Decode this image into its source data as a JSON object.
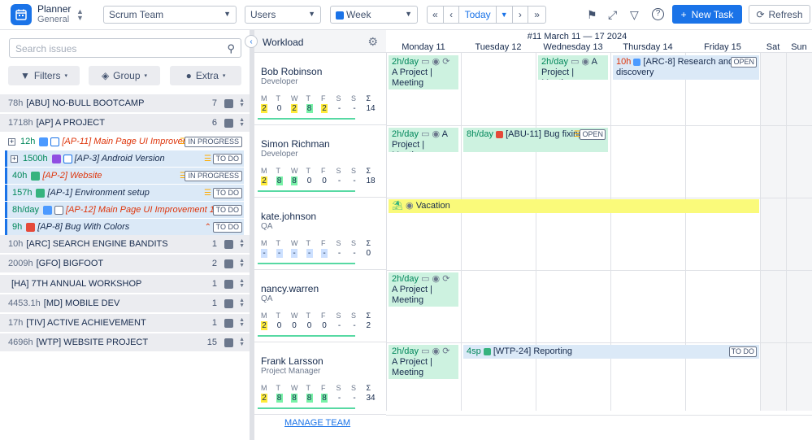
{
  "app": {
    "title": "Planner",
    "subtitle": "General"
  },
  "toolbar": {
    "team": "Scrum Team",
    "view": "Users",
    "range": "Week",
    "today": "Today",
    "new_task": "New Task",
    "refresh": "Refresh"
  },
  "sidebar": {
    "search_placeholder": "Search issues",
    "filters": "Filters",
    "group": "Group",
    "extra": "Extra",
    "projects": [
      {
        "hours": "78h",
        "name": "[ABU] NO-BULL BOOTCAMP",
        "count": "7"
      },
      {
        "hours": "1718h",
        "name": "[AP] A PROJECT",
        "count": "6"
      },
      {
        "hours": "10h",
        "name": "[ARC] SEARCH ENGINE BANDITS",
        "count": "1"
      },
      {
        "hours": "2009h",
        "name": "[GFO] BIGFOOT",
        "count": "2"
      },
      {
        "hours": "",
        "name": "[HA] 7TH ANNUAL WORKSHOP",
        "count": "1"
      },
      {
        "hours": "4453.1h",
        "name": "[MD] MOBILE DEV",
        "count": "1"
      },
      {
        "hours": "17h",
        "name": "[TIV] ACTIVE ACHIEVEMENT",
        "count": "1"
      },
      {
        "hours": "4696h",
        "name": "[WTP] WEBSITE PROJECT",
        "count": "15"
      }
    ],
    "issues": [
      {
        "hours": "12h",
        "title": "[AP-11] Main Page UI Improvem...",
        "status": "IN PROGRESS"
      },
      {
        "hours": "1500h",
        "title": "[AP-3] Android Version",
        "status": "TO DO"
      },
      {
        "hours": "40h",
        "title": "[AP-2] Website",
        "status": "IN PROGRESS"
      },
      {
        "hours": "157h",
        "title": "[AP-1] Environment setup",
        "status": "TO DO"
      },
      {
        "hours": "8h/day",
        "title": "[AP-12] Main Page UI Improvement 1",
        "status": "TO DO"
      },
      {
        "hours": "9h",
        "title": "[AP-8] Bug With Colors",
        "status": "TO DO"
      }
    ]
  },
  "calendar": {
    "workload": "Workload",
    "week_title": "#11 March 11 — 17 2024",
    "days": [
      "Monday 11",
      "Tuesday 12",
      "Wednesday 13",
      "Thursday 14",
      "Friday 15",
      "Sat",
      "Sun"
    ],
    "day_letters": [
      "M",
      "T",
      "W",
      "T",
      "F",
      "S",
      "S",
      "Σ"
    ],
    "manage_team": "MANAGE TEAM"
  },
  "members": [
    {
      "name": "Bob Robinson",
      "role": "Developer",
      "vals": [
        "2",
        "0",
        "2",
        "8",
        "2",
        "-",
        "-",
        "14"
      ]
    },
    {
      "name": "Simon Richman",
      "role": "Developer",
      "vals": [
        "2",
        "8",
        "8",
        "0",
        "0",
        "-",
        "-",
        "18"
      ]
    },
    {
      "name": "kate.johnson",
      "role": "QA",
      "vals": [
        "-",
        "-",
        "-",
        "-",
        "-",
        "-",
        "-",
        "0"
      ]
    },
    {
      "name": "nancy.warren",
      "role": "QA",
      "vals": [
        "2",
        "0",
        "0",
        "0",
        "0",
        "-",
        "-",
        "2"
      ]
    },
    {
      "name": "Frank Larsson",
      "role": "Project Manager",
      "vals": [
        "2",
        "8",
        "8",
        "8",
        "8",
        "-",
        "-",
        "34"
      ]
    }
  ],
  "tasks": {
    "meeting_rate": "2h/day",
    "meeting_title": "A Project | Meeting",
    "arc8_hours": "10h",
    "arc8_title": "[ARC-8] Research and discovery",
    "arc8_status": "OPEN",
    "abu11_hours": "8h/day",
    "abu11_title": "[ABU-11] Bug fixing",
    "abu11_status": "OPEN",
    "vacation": "Vacation",
    "wtp24_hours": "4sp",
    "wtp24_title": "[WTP-24] Reporting",
    "wtp24_status": "TO DO"
  }
}
